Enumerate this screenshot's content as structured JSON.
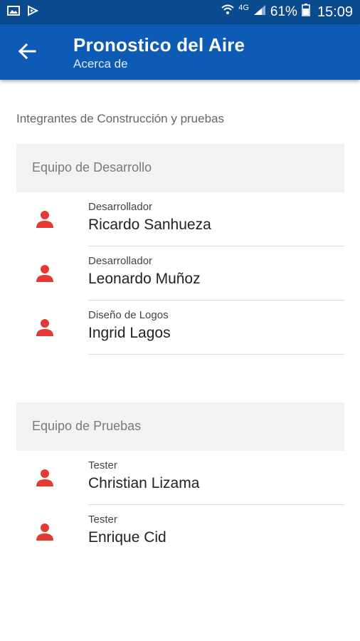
{
  "status_bar": {
    "network": "4G",
    "battery_percent": "61%",
    "time": "15:09"
  },
  "app_bar": {
    "title": "Pronostico del Aire",
    "subtitle": "Acerca de"
  },
  "section_heading": "Integrantes de Construcción y pruebas",
  "groups": [
    {
      "header": "Equipo de Desarrollo",
      "members": [
        {
          "role": "Desarrollador",
          "name": "Ricardo Sanhueza"
        },
        {
          "role": "Desarrollador",
          "name": "Leonardo Muñoz"
        },
        {
          "role": "Diseño de Logos",
          "name": "Ingrid Lagos"
        }
      ]
    },
    {
      "header": "Equipo de Pruebas",
      "members": [
        {
          "role": "Tester",
          "name": "Christian Lizama"
        },
        {
          "role": "Tester",
          "name": "Enrique Cid"
        }
      ]
    }
  ],
  "colors": {
    "status_bar": "#0a4a8e",
    "app_bar": "#0d5bb5",
    "person_icon": "#e53935",
    "group_header_bg": "#f2f2f2"
  }
}
